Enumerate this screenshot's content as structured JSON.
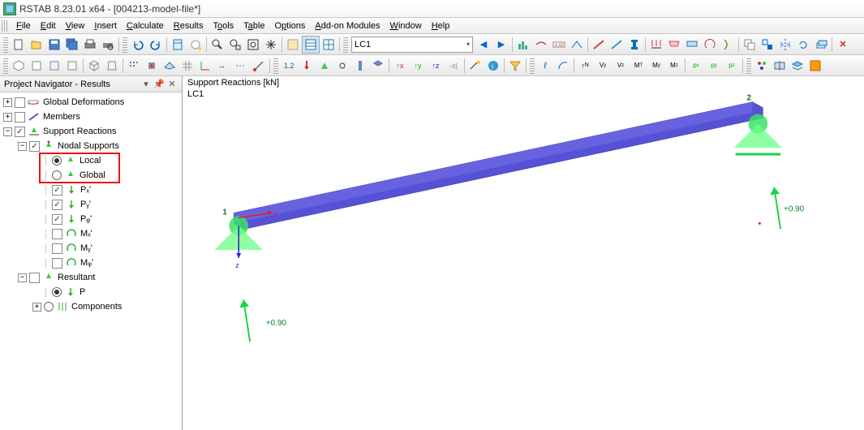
{
  "title": "RSTAB 8.23.01 x64 - [004213-model-file*]",
  "menu": [
    "File",
    "Edit",
    "View",
    "Insert",
    "Calculate",
    "Results",
    "Tools",
    "Table",
    "Options",
    "Add-on Modules",
    "Window",
    "Help"
  ],
  "loadcase": "LC1",
  "navigator": {
    "title": "Project Navigator - Results",
    "items": {
      "global_def": "Global Deformations",
      "members": "Members",
      "support_reactions": "Support Reactions",
      "nodal_supports": "Nodal Supports",
      "local": "Local",
      "global": "Global",
      "px": "Pₓ'",
      "py": "Pᵧ'",
      "pz": "Pᵩ'",
      "mx": "Mₓ'",
      "my": "Mᵧ'",
      "mz": "Mᵩ'",
      "resultant": "Resultant",
      "p": "P",
      "components": "Components"
    }
  },
  "viewport": {
    "title": "Support Reactions [kN]",
    "lc": "LC1",
    "node1": "1",
    "node2": "2",
    "value1": "+0.90",
    "value2": "+0.90",
    "axis_x": "x",
    "axis_z": "z"
  }
}
